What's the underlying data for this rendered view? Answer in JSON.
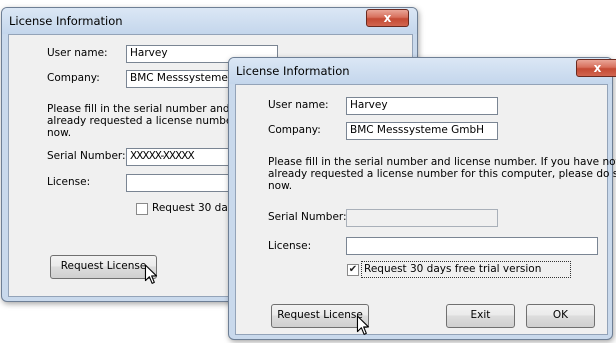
{
  "back_window": {
    "title": "License Information",
    "close_glyph": "x",
    "user_name": {
      "label": "User name:",
      "value": "Harvey"
    },
    "company": {
      "label": "Company:",
      "value": "BMC Messsysteme"
    },
    "info_lines": [
      "Please fill in the serial number and lic",
      "already requested a license number f",
      "now."
    ],
    "serial_number": {
      "label": "Serial Number:",
      "value": "XXXXX-XXXXX"
    },
    "license": {
      "label": "License:",
      "value": ""
    },
    "trial_checkbox": {
      "label": "Request 30 day",
      "checked": false
    },
    "request_button": "Request License"
  },
  "front_window": {
    "title": "License Information",
    "close_glyph": "x",
    "user_name": {
      "label": "User name:",
      "value": "Harvey"
    },
    "company": {
      "label": "Company:",
      "value": "BMC Messsysteme GmbH"
    },
    "info_lines": [
      "Please fill in the serial number and license number. If you have not",
      "already requested a license number for this computer, please do so",
      "now."
    ],
    "serial_number": {
      "label": "Serial Number:",
      "value": ""
    },
    "license": {
      "label": "License:",
      "value": ""
    },
    "trial_checkbox": {
      "label": "Request 30 days free trial version",
      "checked": true,
      "check_glyph": "✔"
    },
    "request_button": "Request License",
    "exit_button": "Exit",
    "ok_button": "OK"
  }
}
